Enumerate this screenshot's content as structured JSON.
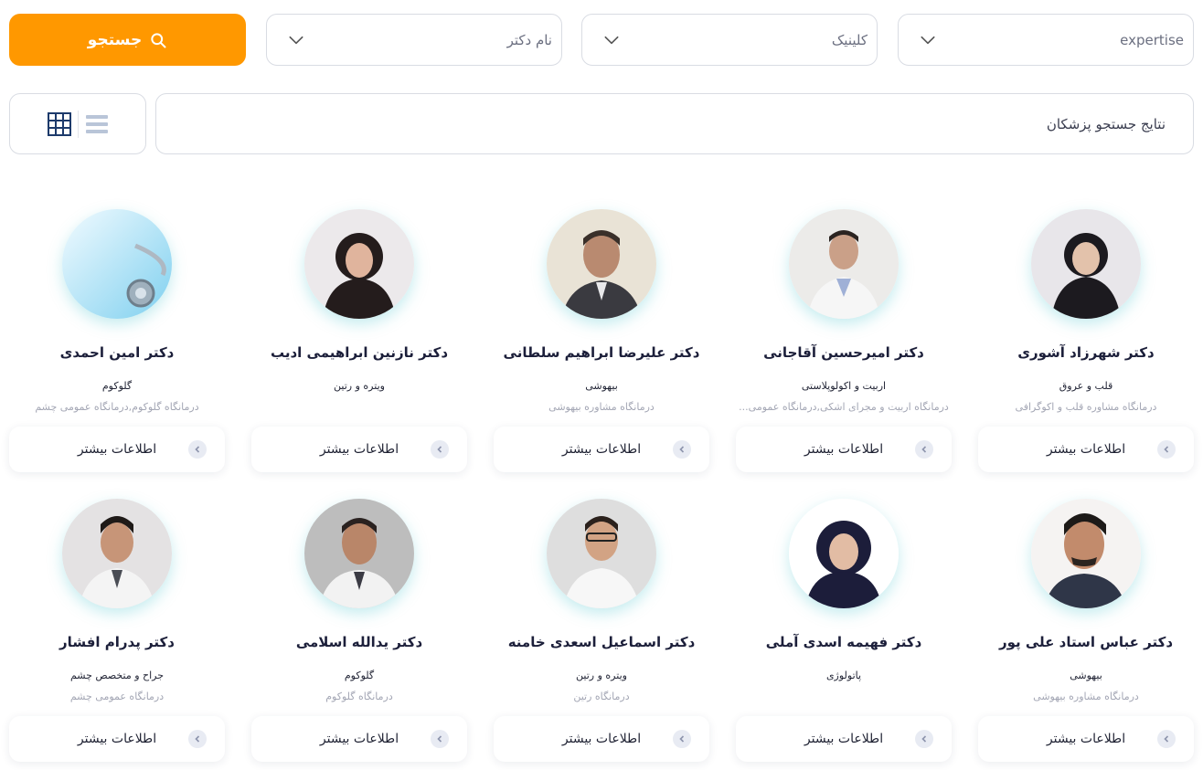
{
  "filters": {
    "search_label": "جستجو",
    "doctor_name": "نام دکتر",
    "clinic": "کلینیک",
    "expertise": "expertise"
  },
  "results": {
    "title": "نتایج جستجو پزشکان"
  },
  "card_button_label": "اطلاعات بیشتر",
  "doctors": [
    {
      "name": "دکتر شهرزاد آشوری",
      "specialty": "قلب و عروق",
      "clinic": "درمانگاه مشاوره قلب و اکوگرافی",
      "avatar": "female-hijab"
    },
    {
      "name": "دکتر امیرحسین آقاجانی",
      "specialty": "اربیت و اکولوپلاستی",
      "clinic": "درمانگاه اربیت و مجرای اشکی,درمانگاه عمومی...",
      "avatar": "male-coat"
    },
    {
      "name": "دکتر علیرضا ابراهیم سلطانی",
      "specialty": "بیهوشی",
      "clinic": "درمانگاه مشاوره بیهوشی",
      "avatar": "male-suit"
    },
    {
      "name": "دکتر نازنین ابراهیمی ادیب",
      "specialty": "ویتره و رتین",
      "clinic": "",
      "avatar": "female-hijab"
    },
    {
      "name": "دکتر امین احمدی",
      "specialty": "گلوکوم",
      "clinic": "درمانگاه گلوکوم,درمانگاه عمومی چشم",
      "avatar": "stethoscope-placeholder"
    },
    {
      "name": "دکتر عباس استاد علی پور",
      "specialty": "بیهوشی",
      "clinic": "درمانگاه مشاوره بیهوشی",
      "avatar": "male-suit"
    },
    {
      "name": "دکتر فهیمه اسدی آملی",
      "specialty": "پاتولوژی",
      "clinic": "",
      "avatar": "female-hijab"
    },
    {
      "name": "دکتر اسماعیل اسعدی خامنه",
      "specialty": "ویتره و رتین",
      "clinic": "درمانگاه رتین",
      "avatar": "male-coat"
    },
    {
      "name": "دکتر یدالله اسلامی",
      "specialty": "گلوکوم",
      "clinic": "درمانگاه گلوکوم",
      "avatar": "male-coat"
    },
    {
      "name": "دکتر پدرام افشار",
      "specialty": "جراح و متخصص چشم",
      "clinic": "درمانگاه عمومی چشم",
      "avatar": "male-coat"
    }
  ]
}
